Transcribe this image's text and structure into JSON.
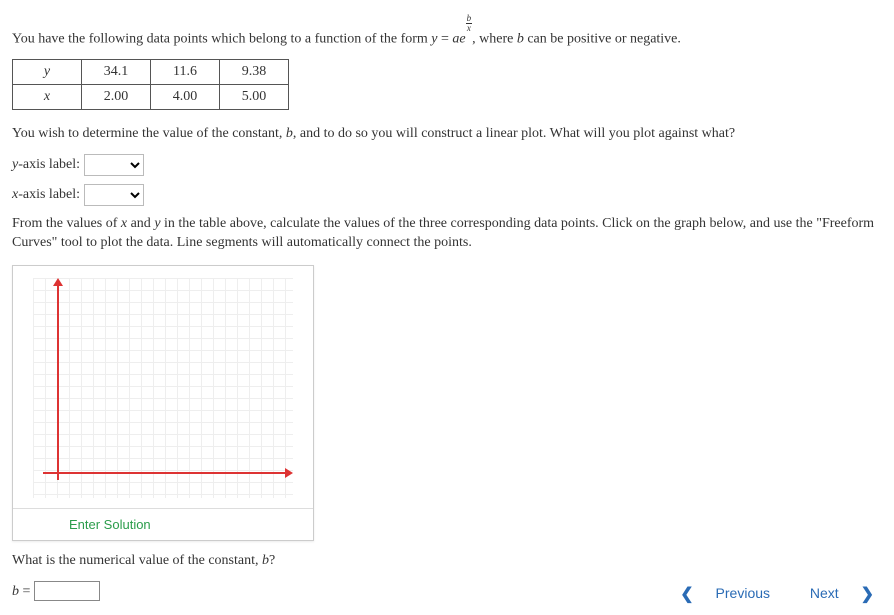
{
  "intro_a": "You have the following data points which belong to a function of the form ",
  "intro_eq_y": "y",
  "intro_eq_eq": " = ",
  "intro_eq_ae": "ae",
  "intro_eq_frac_top": "b",
  "intro_eq_frac_bot": "x",
  "intro_b": ", where ",
  "intro_b_var": "b",
  "intro_c": " can be positive or negative.",
  "table": {
    "row_y_label": "y",
    "row_y": [
      "34.1",
      "11.6",
      "9.38"
    ],
    "row_x_label": "x",
    "row_x": [
      "2.00",
      "4.00",
      "5.00"
    ]
  },
  "para2_a": "You wish to determine the value of the constant, ",
  "para2_b": "b",
  "para2_c": ", and to do so you will construct a linear plot. What will you plot against what?",
  "ylabel_a": "y",
  "ylabel_b": "-axis label:",
  "xlabel_a": "x",
  "xlabel_b": "-axis label:",
  "para3_a": "From the values of ",
  "para3_x": "x",
  "para3_and": " and ",
  "para3_y": "y",
  "para3_b": " in the table above, calculate the values of the three corresponding data points. Click on the graph below, and use the \"Freeform Curves\" tool to plot the data. Line segments will automatically connect the points.",
  "enter_solution": "Enter Solution",
  "question_a": "What is the numerical value of the constant, ",
  "question_b": "b",
  "question_c": "?",
  "b_eq_a": "b",
  "b_eq_b": " = ",
  "nav": {
    "previous": "Previous",
    "next": "Next"
  }
}
